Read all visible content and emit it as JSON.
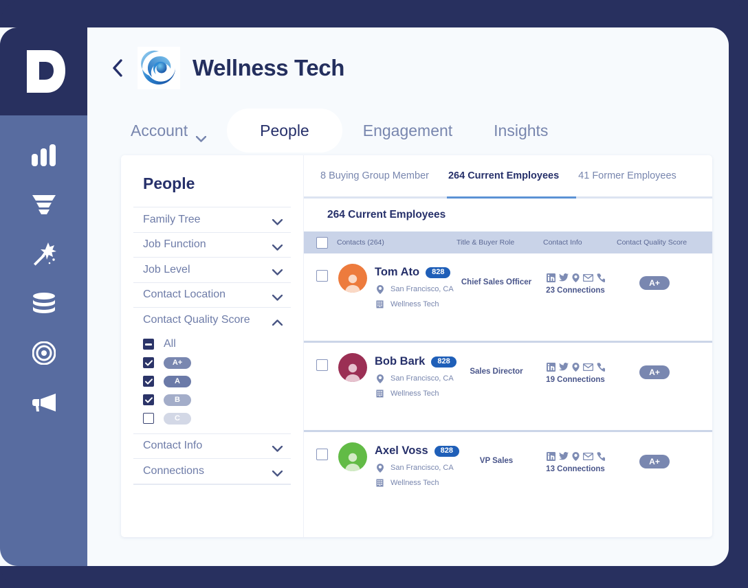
{
  "brand": {
    "logo_letter": "D",
    "rail_bg": "#586CA0",
    "frame_bg": "#28305F",
    "accent": "#5B92D4"
  },
  "nav_rail": {
    "items": [
      {
        "name": "bar-chart-icon",
        "label": "Analytics"
      },
      {
        "name": "funnel-icon",
        "label": "Funnel"
      },
      {
        "name": "magic-wand-icon",
        "label": "Enrich"
      },
      {
        "name": "database-icon",
        "label": "Data"
      },
      {
        "name": "target-icon",
        "label": "Targeting"
      },
      {
        "name": "megaphone-icon",
        "label": "Campaigns"
      }
    ]
  },
  "header": {
    "back_label": "Back",
    "title": "Wellness Tech",
    "logo_alt": "Wellness Tech"
  },
  "top_tabs": [
    {
      "label": "Account",
      "active": false,
      "has_caret": true
    },
    {
      "label": "People",
      "active": true,
      "has_caret": false
    },
    {
      "label": "Engagement",
      "active": false,
      "has_caret": false
    },
    {
      "label": "Insights",
      "active": false,
      "has_caret": false
    }
  ],
  "filters": {
    "title": "People",
    "groups": [
      {
        "label": "Family Tree",
        "open": false
      },
      {
        "label": "Job Function",
        "open": false
      },
      {
        "label": "Job Level",
        "open": false
      },
      {
        "label": "Contact Location",
        "open": false
      },
      {
        "label": "Contact Quality Score",
        "open": true
      },
      {
        "label": "Contact Info",
        "open": false
      },
      {
        "label": "Connections",
        "open": false
      }
    ],
    "quality_score": {
      "options": [
        {
          "label": "All",
          "state": "indeterminate",
          "pill": false,
          "color": ""
        },
        {
          "label": "A+",
          "state": "checked",
          "pill": true,
          "color": "#7987B0"
        },
        {
          "label": "A",
          "state": "checked",
          "pill": true,
          "color": "#6B7AA8"
        },
        {
          "label": "B",
          "state": "checked",
          "pill": true,
          "color": "#A3ADC9"
        },
        {
          "label": "C",
          "state": "unchecked",
          "pill": true,
          "color": "#D3D8E6"
        }
      ]
    }
  },
  "content": {
    "sub_tabs": [
      {
        "label": "8 Buying Group Member",
        "active": false
      },
      {
        "label": "264 Current Employees",
        "active": true
      },
      {
        "label": "41 Former Employees",
        "active": false
      }
    ],
    "list_heading": "264 Current Employees",
    "table_headers": {
      "contacts": "Contacts (264)",
      "title_role": "Title & Buyer Role",
      "contact_info": "Contact Info",
      "quality_score": "Contact Quality Score"
    },
    "rows": [
      {
        "name": "Tom Ato",
        "score_number": "828",
        "avatar_color": "#ED7B3D",
        "location": "San Francisco, CA",
        "company": "Wellness Tech",
        "title": "Chief Sales Officer",
        "connections": "23 Connections",
        "contact_icons": [
          "linkedin-icon",
          "twitter-icon",
          "location-pin-icon",
          "email-icon",
          "phone-icon"
        ],
        "quality_score": "A+",
        "quality_color": "#7987B0"
      },
      {
        "name": "Bob Bark",
        "score_number": "828",
        "avatar_color": "#9B2F54",
        "location": "San Francisco, CA",
        "company": "Wellness Tech",
        "title": "Sales Director",
        "connections": "19 Connections",
        "contact_icons": [
          "linkedin-icon",
          "twitter-icon",
          "location-pin-icon",
          "email-icon",
          "phone-icon"
        ],
        "quality_score": "A+",
        "quality_color": "#7987B0"
      },
      {
        "name": "Axel Voss",
        "score_number": "828",
        "avatar_color": "#62BB46",
        "location": "San Francisco, CA",
        "company": "Wellness Tech",
        "title": "VP Sales",
        "connections": "13 Connections",
        "contact_icons": [
          "linkedin-icon",
          "twitter-icon",
          "location-pin-icon",
          "email-icon",
          "phone-icon"
        ],
        "quality_score": "A+",
        "quality_color": "#7987B0"
      }
    ]
  }
}
